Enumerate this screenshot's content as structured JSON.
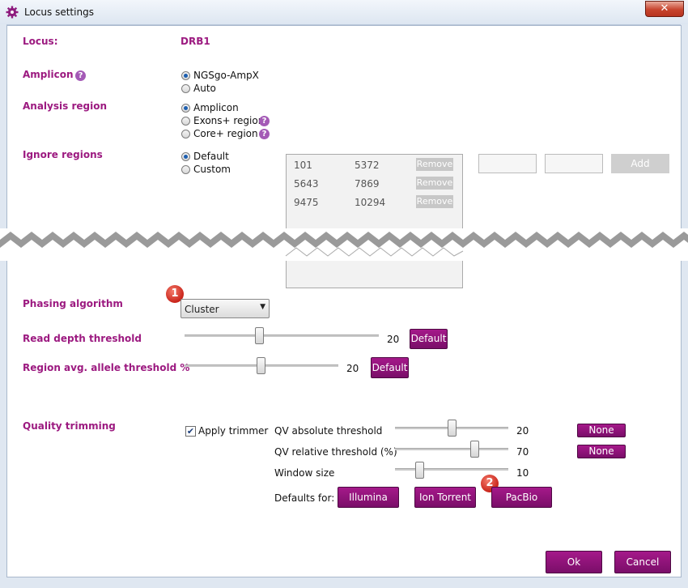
{
  "window": {
    "title": "Locus settings",
    "close": "✕"
  },
  "locus": {
    "label": "Locus:",
    "value": "DRB1"
  },
  "amplicon": {
    "label": "Amplicon",
    "options": [
      "NGSgo-AmpX",
      "Auto"
    ],
    "selected": 0
  },
  "analysis_region": {
    "label": "Analysis region",
    "options": [
      "Amplicon",
      "Exons+ region",
      "Core+ region"
    ],
    "selected": 0
  },
  "ignore_regions": {
    "label": "Ignore regions",
    "options": [
      "Default",
      "Custom"
    ],
    "selected": 0,
    "rows": [
      {
        "start": "101",
        "end": "5372",
        "action": "Remove"
      },
      {
        "start": "5643",
        "end": "7869",
        "action": "Remove"
      },
      {
        "start": "9475",
        "end": "10294",
        "action": "Remove"
      }
    ],
    "add_label": "Add"
  },
  "phasing": {
    "label": "Phasing algorithm",
    "value": "Cluster",
    "step": "1"
  },
  "read_depth": {
    "label": "Read depth threshold",
    "value": "20",
    "default_label": "Default"
  },
  "region_avg": {
    "label": "Region avg. allele threshold %",
    "value": "20",
    "default_label": "Default"
  },
  "quality": {
    "label": "Quality trimming",
    "apply_label": "Apply trimmer",
    "apply_checked": true,
    "qv_abs": {
      "label": "QV absolute threshold",
      "value": "20",
      "button": "None"
    },
    "qv_rel": {
      "label": "QV relative threshold (%)",
      "value": "70",
      "button": "None"
    },
    "window": {
      "label": "Window size",
      "value": "10"
    },
    "defaults_label": "Defaults for:",
    "presets": [
      "Illumina",
      "Ion Torrent",
      "PacBio"
    ],
    "step": "2"
  },
  "footer": {
    "ok": "Ok",
    "cancel": "Cancel"
  },
  "colors": {
    "accent": "#9c1a80",
    "button": "#8a1278"
  }
}
